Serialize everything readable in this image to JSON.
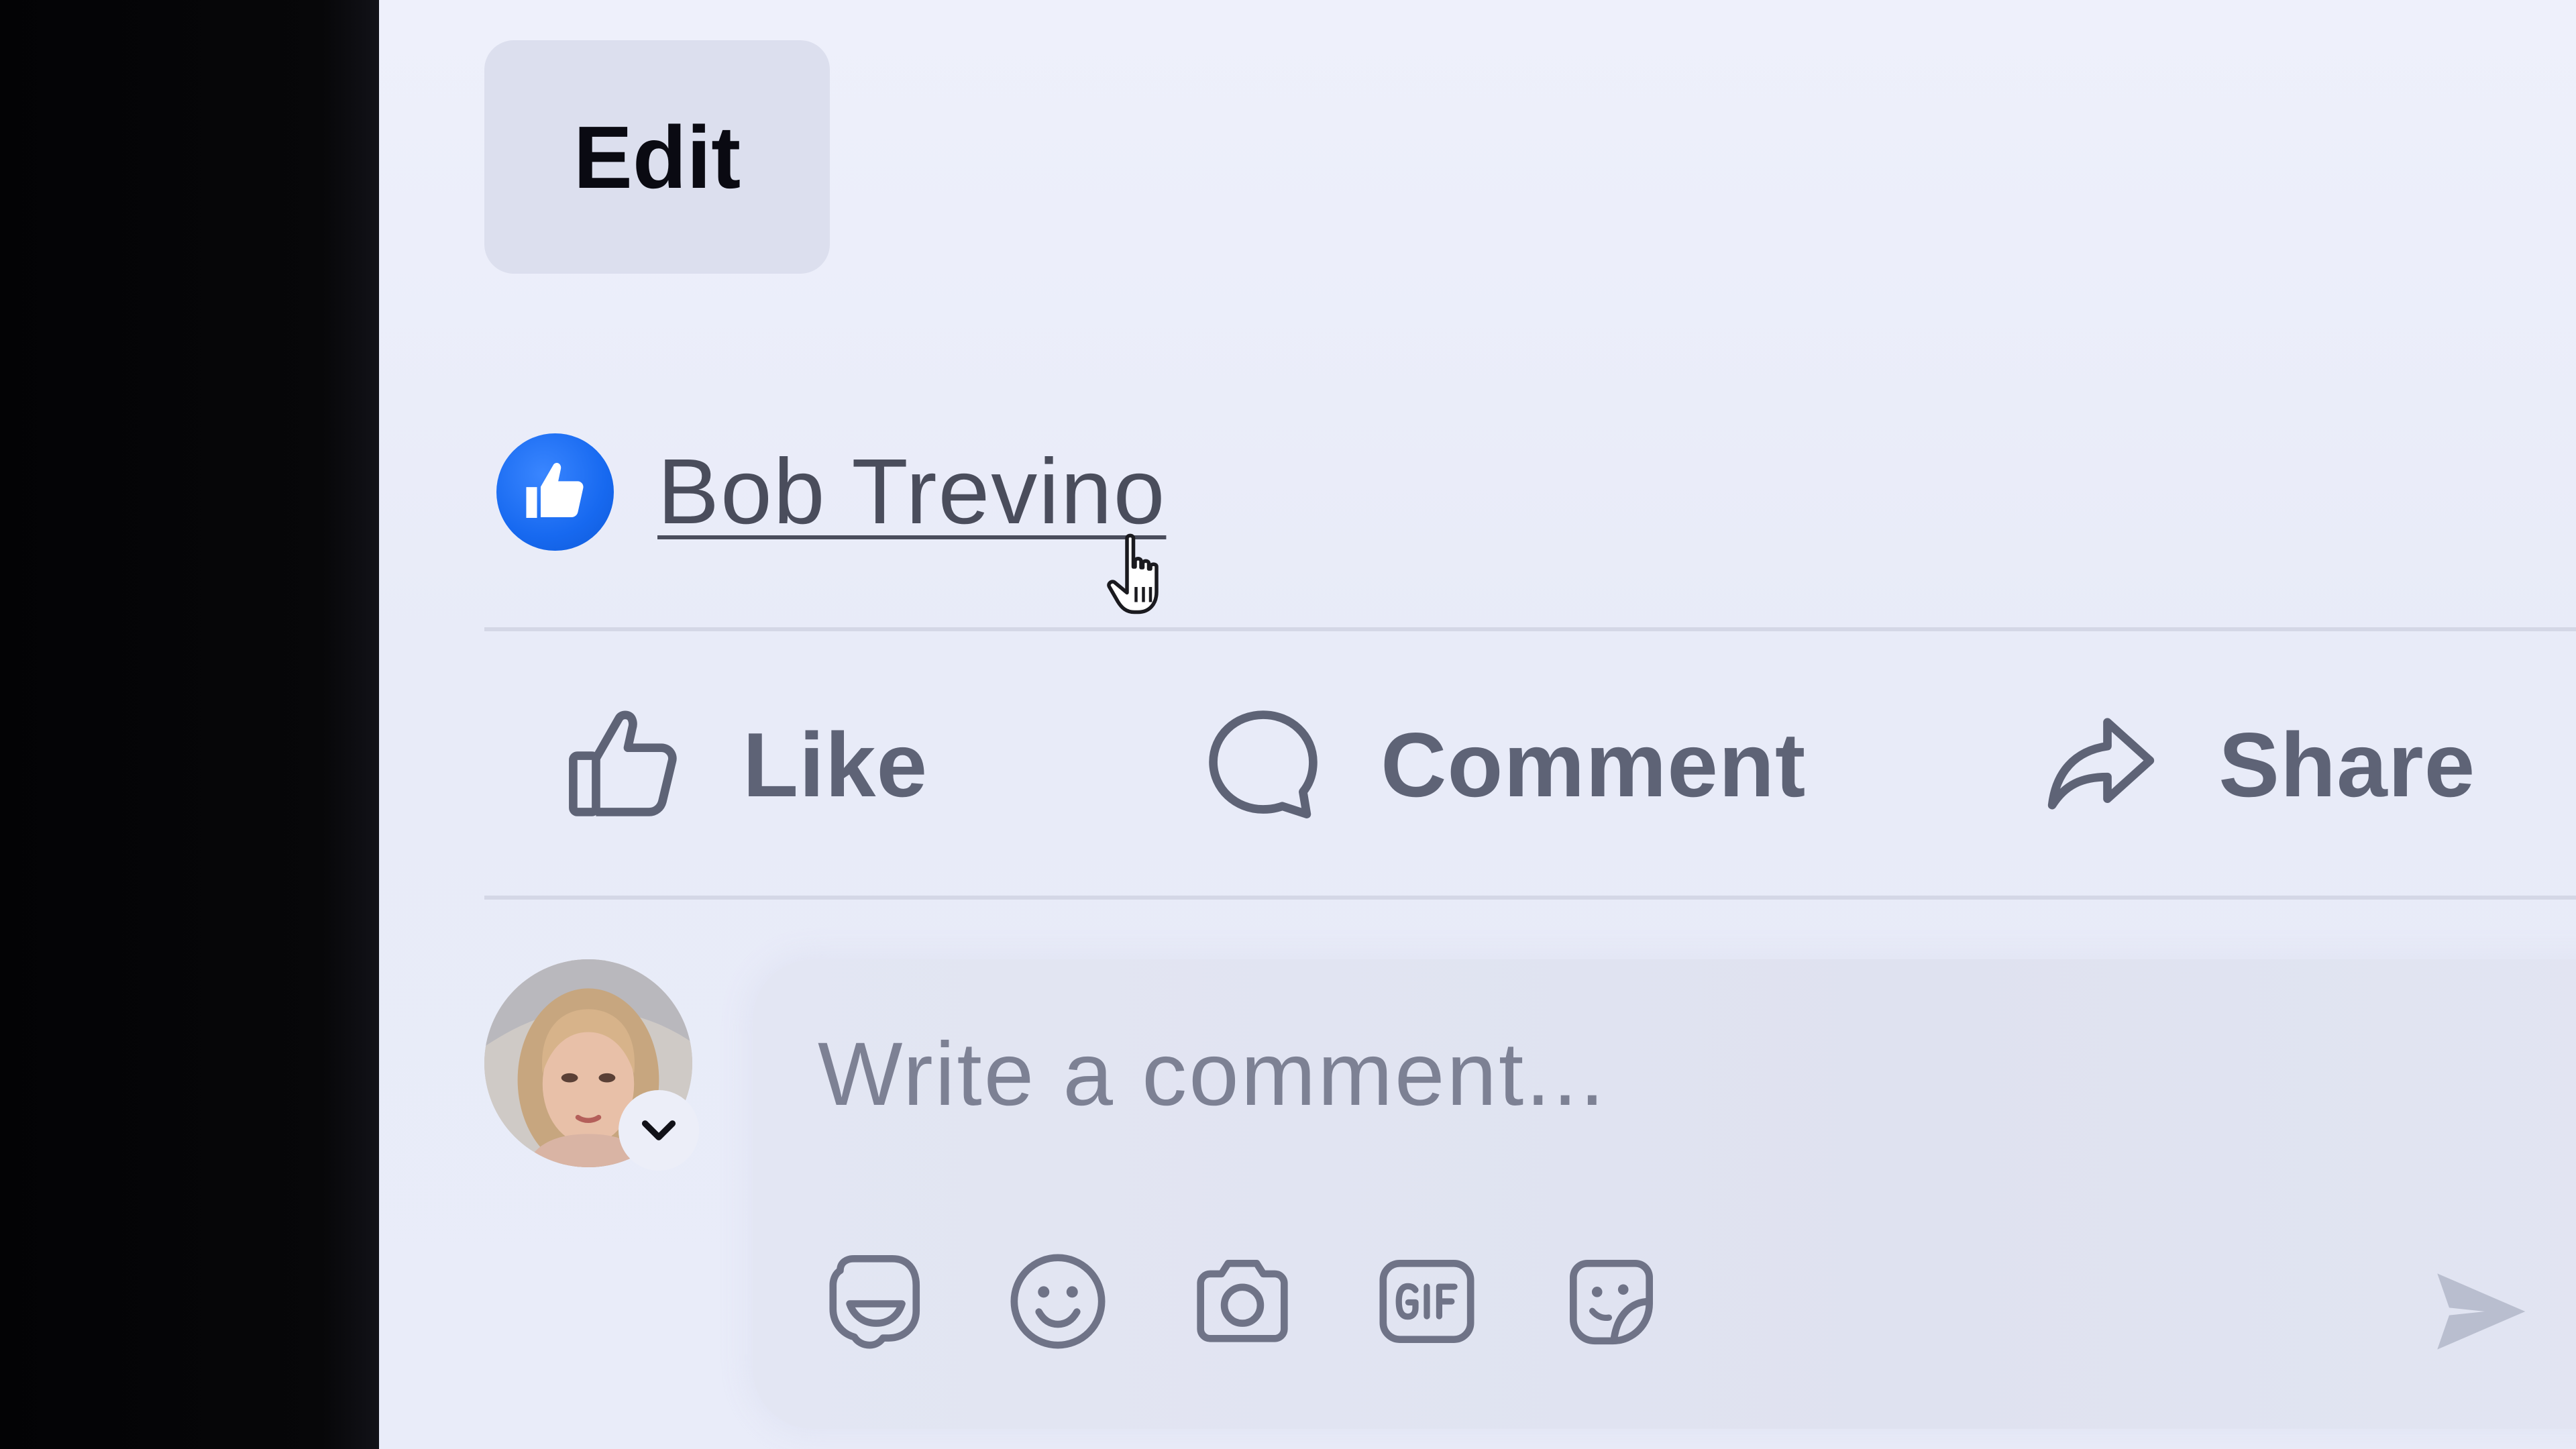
{
  "post": {
    "edit_label": "Edit",
    "reactions": {
      "liker_name": "Bob Trevino",
      "reaction_icon": "like-icon",
      "reaction_color": "#1769f0"
    },
    "actions": [
      {
        "label": "Like",
        "icon": "thumbs-up-outline-icon"
      },
      {
        "label": "Comment",
        "icon": "speech-bubble-icon"
      },
      {
        "label": "Share",
        "icon": "share-arrow-icon"
      }
    ]
  },
  "composer": {
    "placeholder": "Write a comment...",
    "avatar": "user-avatar",
    "tools": [
      {
        "name": "avatar-sticker-icon"
      },
      {
        "name": "emoji-icon"
      },
      {
        "name": "camera-icon"
      },
      {
        "name": "gif-icon"
      },
      {
        "name": "sticker-icon"
      }
    ],
    "send_icon": "send-icon"
  },
  "colors": {
    "screen_background": "#eef0fb",
    "bezel": "#050507",
    "accent": "#1769f0",
    "action_text": "#5e6376",
    "divider": "#d4d7e6"
  }
}
